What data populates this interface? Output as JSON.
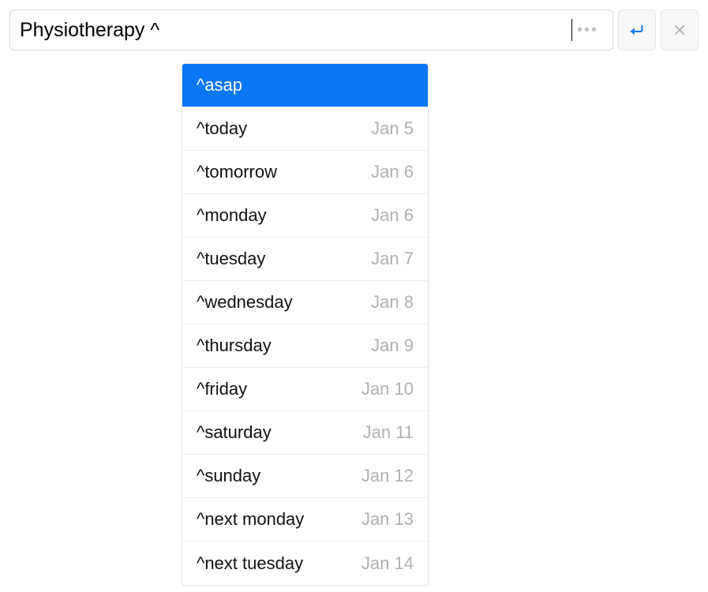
{
  "input": {
    "value": "Physiotherapy ^"
  },
  "suggestions": [
    {
      "label": "^asap",
      "date": "",
      "selected": true
    },
    {
      "label": "^today",
      "date": "Jan 5",
      "selected": false
    },
    {
      "label": "^tomorrow",
      "date": "Jan 6",
      "selected": false
    },
    {
      "label": "^monday",
      "date": "Jan 6",
      "selected": false
    },
    {
      "label": "^tuesday",
      "date": "Jan 7",
      "selected": false
    },
    {
      "label": "^wednesday",
      "date": "Jan 8",
      "selected": false
    },
    {
      "label": "^thursday",
      "date": "Jan 9",
      "selected": false
    },
    {
      "label": "^friday",
      "date": "Jan 10",
      "selected": false
    },
    {
      "label": "^saturday",
      "date": "Jan 11",
      "selected": false
    },
    {
      "label": "^sunday",
      "date": "Jan 12",
      "selected": false
    },
    {
      "label": "^next monday",
      "date": "Jan 13",
      "selected": false
    },
    {
      "label": "^next tuesday",
      "date": "Jan 14",
      "selected": false
    }
  ],
  "colors": {
    "accent": "#0a77f5",
    "muted": "#b0b0b0"
  }
}
